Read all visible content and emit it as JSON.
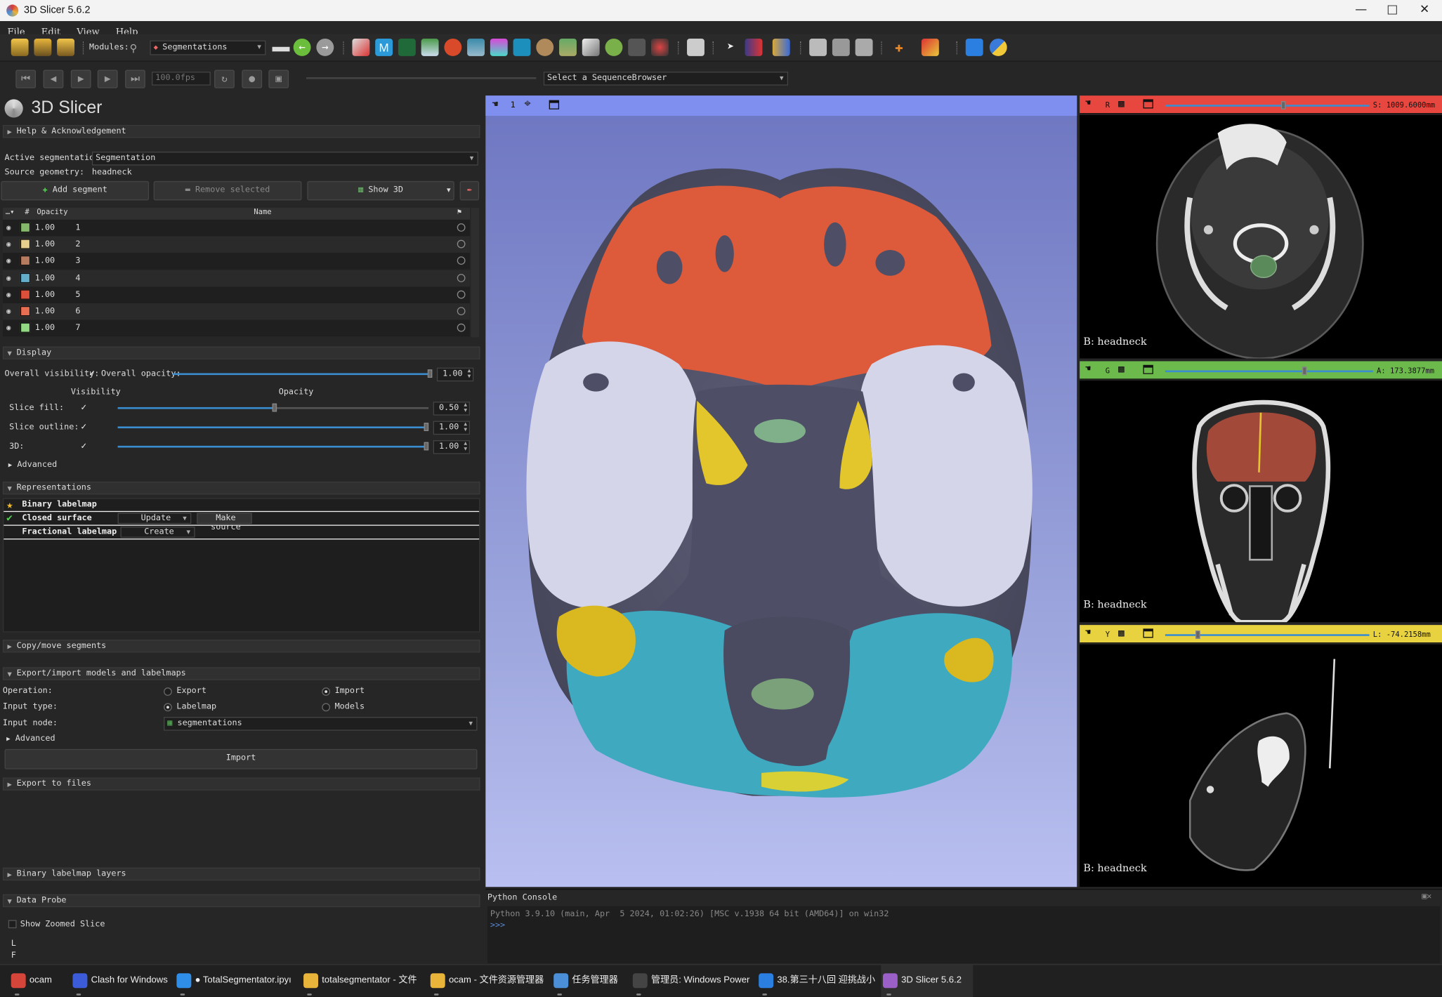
{
  "window": {
    "title": "3D Slicer 5.6.2"
  },
  "menu": [
    "File",
    "Edit",
    "View",
    "Help"
  ],
  "toolbar": {
    "modules_label": "Modules:",
    "module_selected": "Segmentations"
  },
  "sequence": {
    "fps": "100.0fps",
    "browser_placeholder": "Select a SequenceBrowser"
  },
  "logo_text": "3D Slicer",
  "sections": {
    "help": "Help & Acknowledgement",
    "display": "Display",
    "advanced": "Advanced",
    "representations": "Representations",
    "copy_move": "Copy/move segments",
    "export_import": "Export/import models and labelmaps",
    "export_files": "Export to files",
    "binary_layers": "Binary labelmap layers",
    "data_probe": "Data Probe"
  },
  "segmentation": {
    "active_label": "Active segmentation:",
    "active_value": "Segmentation",
    "source_label": "Source geometry:",
    "source_value": "headneck",
    "add_segment": "Add segment",
    "remove_selected": "Remove selected",
    "show_3d": "Show 3D"
  },
  "segment_table": {
    "headers": [
      "#",
      "Opacity",
      "Name"
    ],
    "rows": [
      {
        "opacity": "1.00",
        "name": "1",
        "color": "#86b86b"
      },
      {
        "opacity": "1.00",
        "name": "2",
        "color": "#e8cf8e"
      },
      {
        "opacity": "1.00",
        "name": "3",
        "color": "#b77c5f"
      },
      {
        "opacity": "1.00",
        "name": "4",
        "color": "#63aecb"
      },
      {
        "opacity": "1.00",
        "name": "5",
        "color": "#dc503a"
      },
      {
        "opacity": "1.00",
        "name": "6",
        "color": "#e86e52"
      },
      {
        "opacity": "1.00",
        "name": "7",
        "color": "#91d983"
      }
    ]
  },
  "display": {
    "overall_visibility": "Overall visibility:",
    "overall_opacity": "Overall opacity:",
    "overall_opacity_value": "1.00",
    "visibility_header": "Visibility",
    "opacity_header": "Opacity",
    "slice_fill": "Slice fill:",
    "slice_fill_value": "0.50",
    "slice_outline": "Slice outline:",
    "slice_outline_value": "1.00",
    "three_d": "3D:",
    "three_d_value": "1.00",
    "check": "✓"
  },
  "representations": {
    "binary": "Binary labelmap",
    "closed": "Closed surface",
    "update": "Update",
    "make_source": "Make source",
    "fractional": "Fractional labelmap",
    "create": "Create"
  },
  "export_import": {
    "operation_label": "Operation:",
    "export": "Export",
    "import": "Import",
    "input_type_label": "Input type:",
    "labelmap": "Labelmap",
    "models": "Models",
    "input_node_label": "Input node:",
    "input_node_value": "segmentations",
    "advanced": "Advanced",
    "import_button": "Import"
  },
  "data_probe": {
    "show_zoomed": "Show Zoomed Slice",
    "l": "L",
    "f": "F"
  },
  "view3d": {
    "number": "1"
  },
  "slices": {
    "red": {
      "letter": "R",
      "offset": "S: 1009.6000mm",
      "caption": "B: headneck"
    },
    "green": {
      "letter": "G",
      "offset": "A: 173.3877mm",
      "caption": "B: headneck"
    },
    "yellow": {
      "letter": "Y",
      "offset": "L: -74.2158mm",
      "caption": "B: headneck"
    }
  },
  "console": {
    "title": "Python Console",
    "line1": "Python 3.9.10 (main, Apr  5 2024, 01:02:26) [MSC v.1938 64 bit (AMD64)] on win32",
    "prompt": ">>>"
  },
  "taskbar": [
    {
      "label": "ocam",
      "color": "#d6453a"
    },
    {
      "label": "Clash for Windows",
      "color": "#3c5bd8"
    },
    {
      "label": "● TotalSegmentator.ipyı",
      "color": "#2f8ee8"
    },
    {
      "label": "totalsegmentator - 文件",
      "color": "#e8b43a"
    },
    {
      "label": "ocam - 文件资源管理器",
      "color": "#e8b43a"
    },
    {
      "label": "任务管理器",
      "color": "#4a8fd8"
    },
    {
      "label": "管理员: Windows Power",
      "color": "#444444"
    },
    {
      "label": "38.第三十八回 迎挑战小",
      "color": "#2b7fe0"
    },
    {
      "label": "3D Slicer 5.6.2",
      "color": "#9b5fc8"
    }
  ]
}
